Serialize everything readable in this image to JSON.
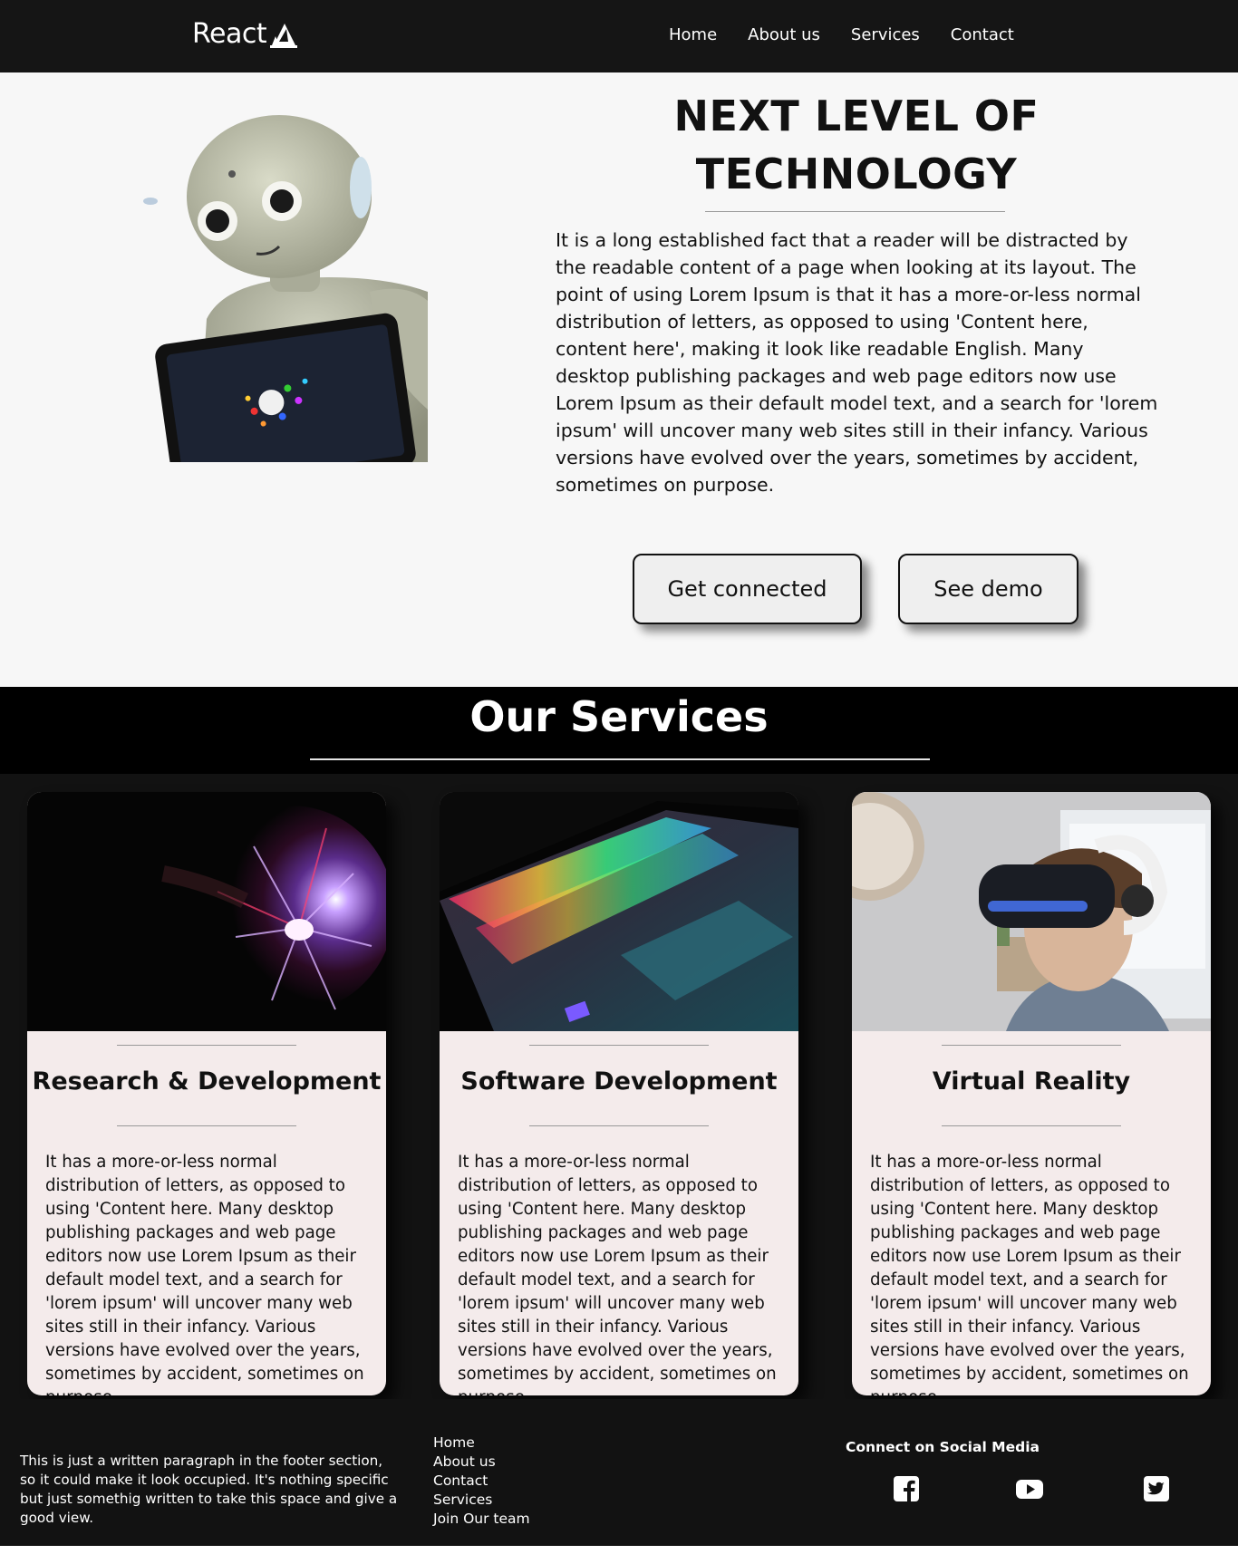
{
  "navbar": {
    "logo_text": "React",
    "links": [
      "Home",
      "About us",
      "Services",
      "Contact"
    ]
  },
  "hero": {
    "title_line1": "NEXT LEVEL OF",
    "title_line2": "TECHNOLOGY",
    "description": "It is a long established fact that a reader will be distracted by the readable content of a page when looking at its layout. The point of using Lorem Ipsum is that it has a more-or-less normal distribution of letters, as opposed to using 'Content here, content here', making it look like readable English. Many desktop publishing packages and web page editors now use Lorem Ipsum as their default model text, and a search for 'lorem ipsum' will uncover many web sites still in their infancy. Various versions have evolved over the years, sometimes by accident, sometimes on purpose.",
    "buttons": {
      "connect": "Get connected",
      "demo": "See demo"
    }
  },
  "services": {
    "title": "Our Services",
    "cards": [
      {
        "title": "Research & Development",
        "image": "plasma-ball-image",
        "text": "It has a more-or-less normal distribution of letters, as opposed to using 'Content here. Many desktop publishing packages and web page editors now use Lorem Ipsum as their default model text, and a search for 'lorem ipsum' will uncover many web sites still in their infancy. Various versions have evolved over the years, sometimes by accident, sometimes on purpose."
      },
      {
        "title": "Software Development",
        "image": "rgb-laptop-keyboard-image",
        "text": "It has a more-or-less normal distribution of letters, as opposed to using 'Content here. Many desktop publishing packages and web page editors now use Lorem Ipsum as their default model text, and a search for 'lorem ipsum' will uncover many web sites still in their infancy. Various versions have evolved over the years, sometimes by accident, sometimes on purpose."
      },
      {
        "title": "Virtual Reality",
        "image": "vr-headset-boy-image",
        "text": "It has a more-or-less normal distribution of letters, as opposed to using 'Content here. Many desktop publishing packages and web page editors now use Lorem Ipsum as their default model text, and a search for 'lorem ipsum' will uncover many web sites still in their infancy. Various versions have evolved over the years, sometimes by accident, sometimes on purpose."
      }
    ]
  },
  "footer": {
    "paragraph": "This is just a written paragraph in the footer section, so it could make it look occupied. It's nothing specific but just somethig written to take this space and give a good view.",
    "links": [
      "Home",
      "About us",
      "Contact",
      "Services",
      "Join Our team"
    ],
    "social_title": "Connect on Social Media",
    "social_icons": [
      "facebook-icon",
      "youtube-icon",
      "twitter-icon"
    ]
  },
  "colors": {
    "nav_bg": "#151515",
    "hero_bg": "#f7f7f7",
    "services_bg": "#121212",
    "card_bg": "#f4ebeb"
  }
}
